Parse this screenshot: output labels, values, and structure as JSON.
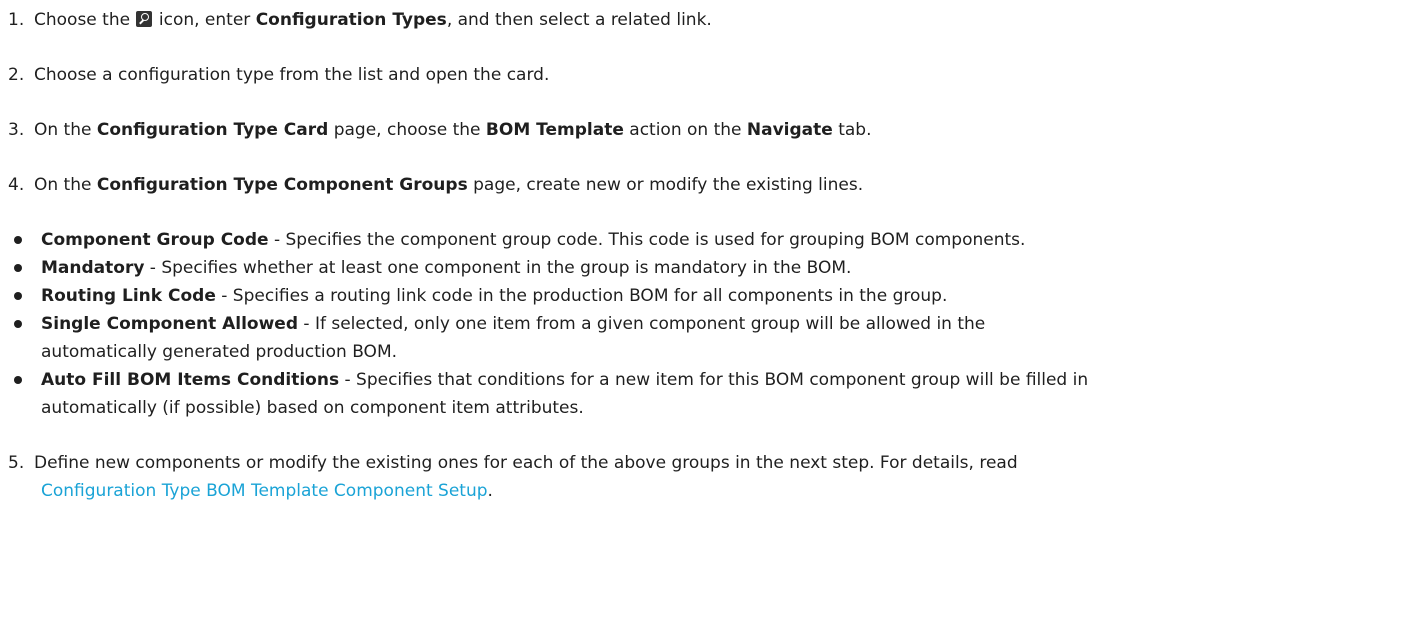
{
  "steps": [
    {
      "number": "1.",
      "pre": "Choose the ",
      "icon": "search-icon",
      "mid": " icon, enter ",
      "bold": "Configuration Types",
      "post": ", and then select a related link."
    },
    {
      "number": "2.",
      "text": "Choose a configuration type from the list and open the card."
    },
    {
      "number": "3.",
      "pre": "On the ",
      "bold1": "Configuration Type Card",
      "mid1": " page, choose the ",
      "bold2": "BOM Template",
      "mid2": " action on the ",
      "bold3": "Navigate",
      "post": " tab."
    },
    {
      "number": "4.",
      "pre": "On the ",
      "bold": "Configuration Type Component Groups",
      "post": " page, create new or modify the existing lines."
    },
    {
      "number": "5.",
      "line1": "Define new components or modify the existing ones for each of the above groups in the next step. For details, read",
      "link": "Configuration Type BOM Template Component Setup",
      "post": "."
    }
  ],
  "fields": [
    {
      "term": "Component Group Code",
      "desc": " - Specifies the component group code. This code is used for grouping BOM components."
    },
    {
      "term": "Mandatory",
      "desc": " - Specifies whether at least one component in the group is mandatory in the BOM."
    },
    {
      "term": "Routing Link Code",
      "desc": " - Specifies a routing link code in the production BOM for all components in the group."
    },
    {
      "term": "Single Component Allowed",
      "desc": " - If selected, only one item from a given component group will be allowed in the",
      "desc2": "automatically generated production BOM."
    },
    {
      "term": "Auto Fill BOM Items Conditions",
      "desc": " - Specifies that conditions for a new item for this BOM component group will be filled in",
      "desc2": "automatically (if possible) based on component item attributes."
    }
  ],
  "colors": {
    "text": "#1f1f1f",
    "link": "#1aa3d6"
  }
}
